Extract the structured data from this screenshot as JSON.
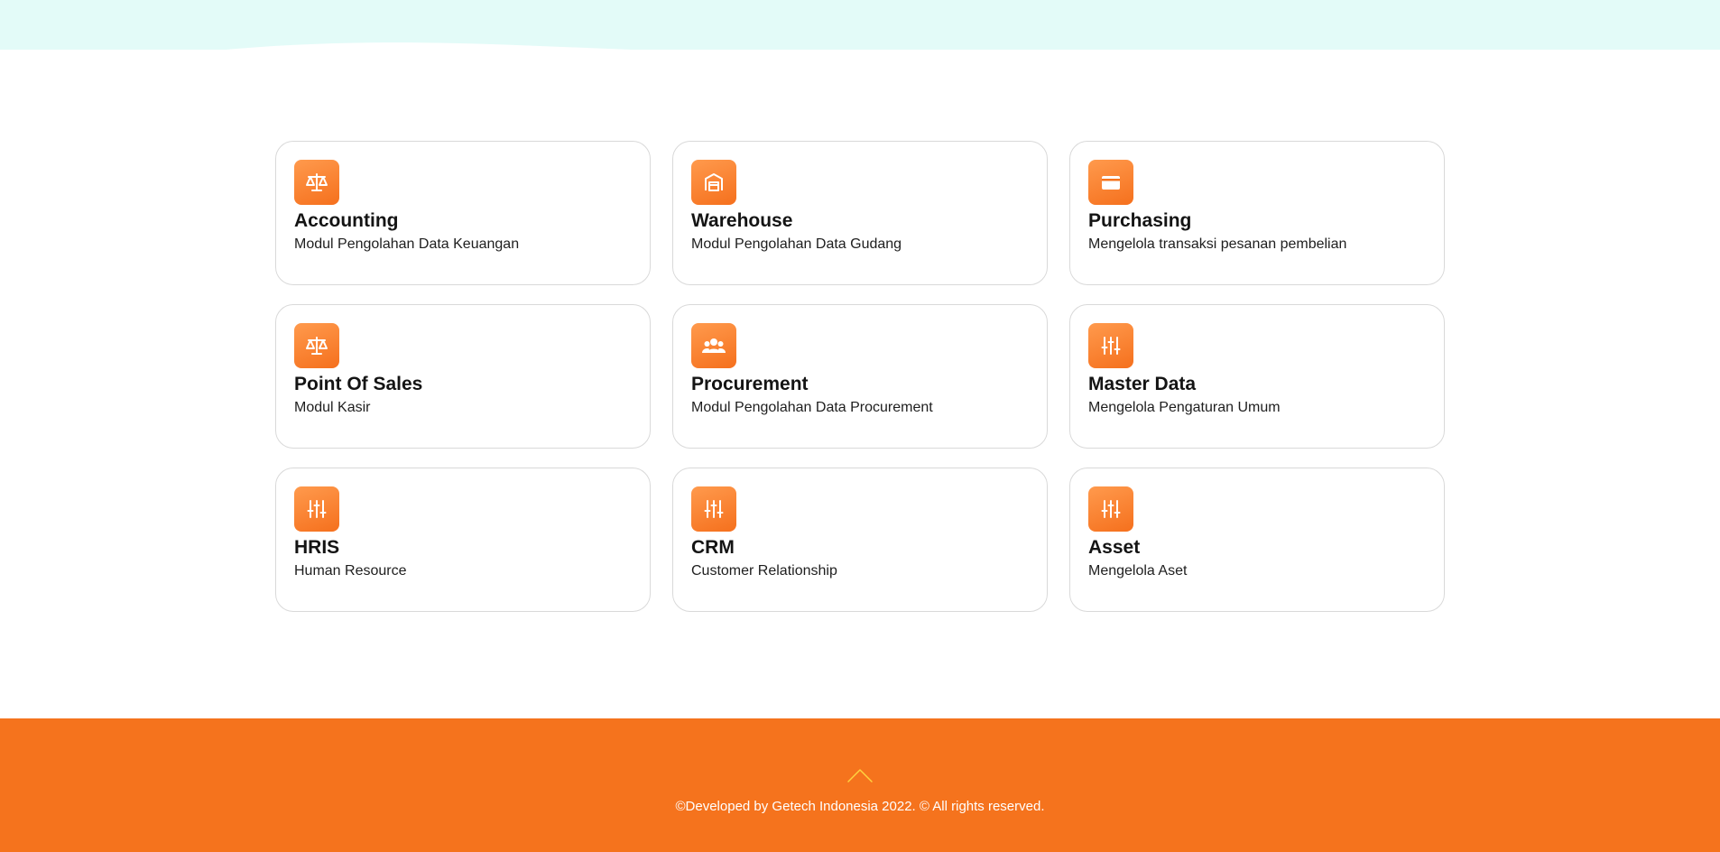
{
  "modules": [
    {
      "title": "Accounting",
      "desc": "Modul Pengolahan Data Keuangan",
      "icon": "scale-icon"
    },
    {
      "title": "Warehouse",
      "desc": "Modul Pengolahan Data Gudang",
      "icon": "warehouse-icon"
    },
    {
      "title": "Purchasing",
      "desc": "Mengelola transaksi pesanan pembelian",
      "icon": "wallet-icon"
    },
    {
      "title": "Point Of Sales",
      "desc": "Modul Kasir",
      "icon": "scale-icon"
    },
    {
      "title": "Procurement",
      "desc": "Modul Pengolahan Data Procurement",
      "icon": "users-icon"
    },
    {
      "title": "Master Data",
      "desc": "Mengelola Pengaturan Umum",
      "icon": "sliders-icon"
    },
    {
      "title": "HRIS",
      "desc": "Human Resource",
      "icon": "sliders-icon"
    },
    {
      "title": "CRM",
      "desc": "Customer Relationship",
      "icon": "sliders-icon"
    },
    {
      "title": "Asset",
      "desc": "Mengelola Aset",
      "icon": "sliders-icon"
    }
  ],
  "footer": {
    "copyright": "©Developed by Getech Indonesia 2022. © All rights reserved.",
    "scroll_top_icon": "chevron-up-icon"
  },
  "colors": {
    "accent": "#f5731d",
    "top_band": "#e3fbf8",
    "card_border": "#d9d9d9"
  }
}
